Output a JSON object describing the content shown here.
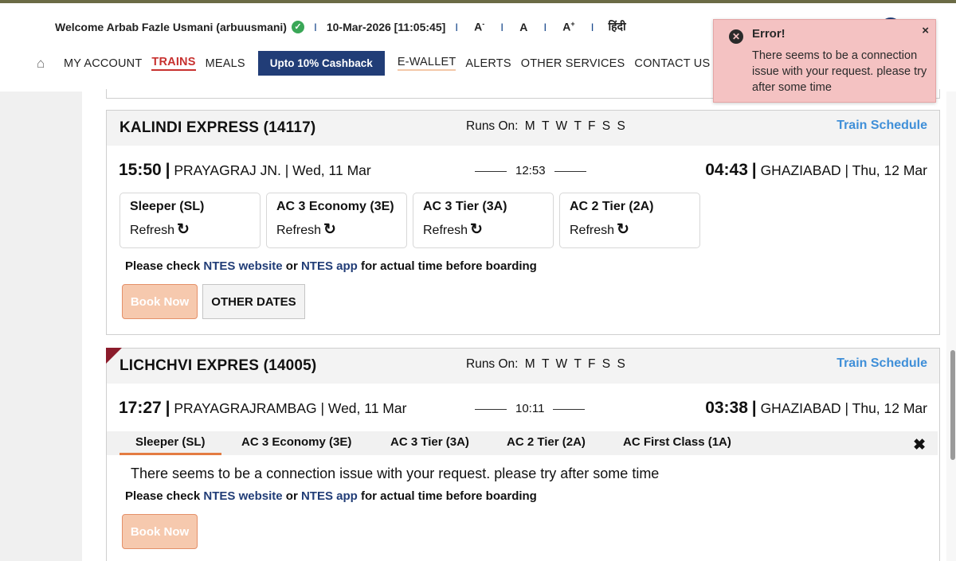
{
  "header": {
    "welcome": "Welcome Arbab Fazle Usmani (arbuusmani)",
    "datetime": "10-Mar-2026 [11:05:45]",
    "font_controls": [
      "A",
      "A",
      "A"
    ],
    "font_small_sup": "-",
    "font_large_sup": "+",
    "language": "हिंदी",
    "separator": "I"
  },
  "nav": {
    "home_icon": "home-icon",
    "items": [
      "MY ACCOUNT",
      "TRAINS",
      "MEALS"
    ],
    "cashback": "Upto 10% Cashback",
    "items_after": [
      "E-WALLET",
      "ALERTS",
      "OTHER SERVICES",
      "CONTACT US"
    ]
  },
  "toast": {
    "title": "Error!",
    "message": "There seems to be a connection issue with your request. please try after some time",
    "close": "×"
  },
  "runs_label": "Runs On:",
  "days": [
    "M",
    "T",
    "W",
    "T",
    "F",
    "S",
    "S"
  ],
  "schedule_label": "Train Schedule",
  "trains": [
    {
      "name": "KALINDI EXPRESS (14117)",
      "dep_time": "15:50",
      "dep_station": "PRAYAGRAJ JN. | Wed, 11 Mar",
      "duration": "12:53",
      "arr_time": "04:43",
      "arr_station": "GHAZIABAD | Thu, 12 Mar",
      "classes": [
        {
          "name": "Sleeper (SL)",
          "action": "Refresh"
        },
        {
          "name": "AC 3 Economy (3E)",
          "action": "Refresh"
        },
        {
          "name": "AC 3 Tier (3A)",
          "action": "Refresh"
        },
        {
          "name": "AC 2 Tier (2A)",
          "action": "Refresh"
        }
      ],
      "book_now": "Book Now",
      "other_dates": "OTHER DATES"
    },
    {
      "name": "LICHCHVI EXPRES (14005)",
      "dep_time": "17:27",
      "dep_station": "PRAYAGRAJRAMBAG | Wed, 11 Mar",
      "duration": "10:11",
      "arr_time": "03:38",
      "arr_station": "GHAZIABAD | Thu, 12 Mar",
      "tabs": [
        "Sleeper (SL)",
        "AC 3 Economy (3E)",
        "AC 3 Tier (3A)",
        "AC 2 Tier (2A)",
        "AC First Class (1A)"
      ],
      "tab_close": "✖",
      "error_message": "There seems to be a connection issue with your request. please try after some time",
      "book_now": "Book Now"
    }
  ],
  "note": {
    "prefix": "Please check",
    "link1": "NTES website",
    "mid": "or",
    "link2": "NTES app",
    "suffix": "for actual time before boarding"
  }
}
